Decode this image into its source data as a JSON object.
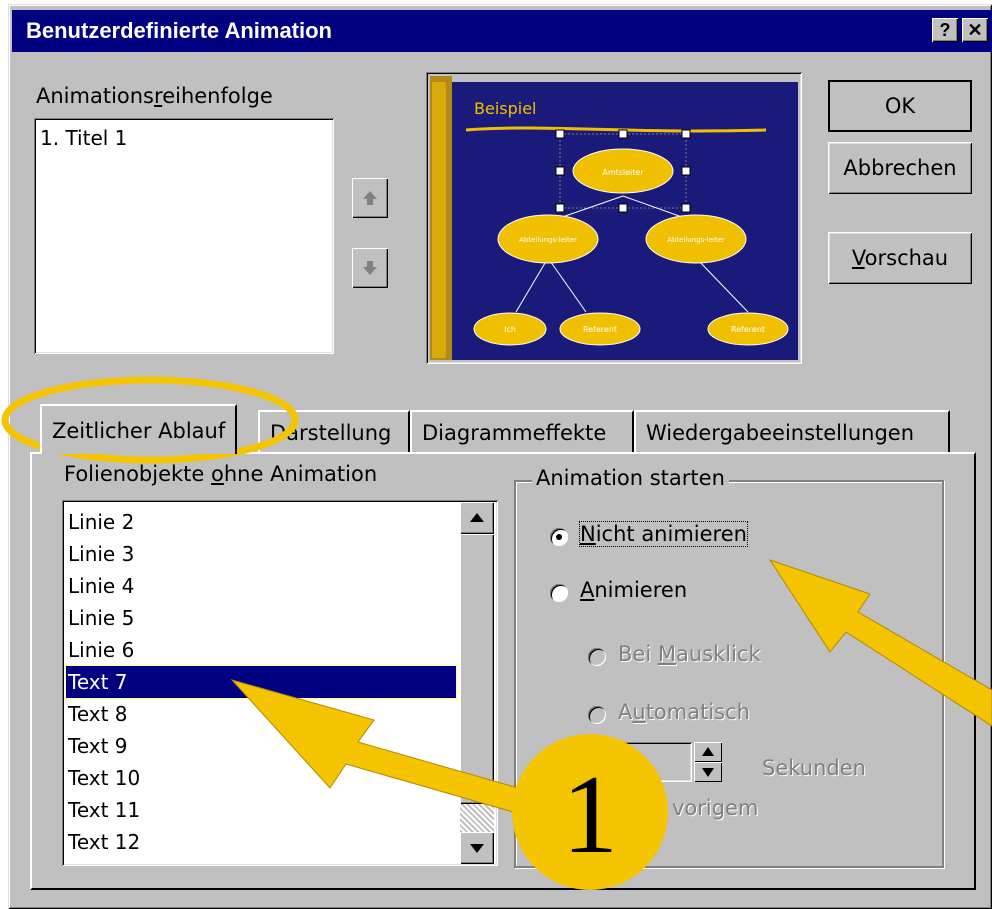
{
  "dialog": {
    "title": "Benutzerdefinierte Animation",
    "help_label": "?",
    "close_label": "✕"
  },
  "order": {
    "label_pre": "Animations",
    "label_u": "r",
    "label_post": "eihenfolge",
    "items": [
      "1. Titel 1"
    ]
  },
  "buttons": {
    "ok": "OK",
    "cancel": "Abbrechen",
    "preview_u": "V",
    "preview_rest": "orschau"
  },
  "slide": {
    "title": "Beispiel",
    "nodes": [
      "Amtsleiter",
      "Abteilungs-leiter",
      "Abteilungs-leiter",
      "Ich",
      "Referent",
      "Referent"
    ],
    "colors": {
      "background": "#1a1a7a",
      "node": "#f0c000",
      "accent": "#f0c000"
    }
  },
  "tabs": [
    "Zeitlicher Ablauf",
    "Darstellung",
    "Diagrammeffekte",
    "Wiedergabeeinstellungen"
  ],
  "objects": {
    "label_pre": "Folienobjekte ",
    "label_u": "o",
    "label_post": "hne Animation",
    "items": [
      "Linie 2",
      "Linie 3",
      "Linie 4",
      "Linie 5",
      "Linie 6",
      "Text 7",
      "Text 8",
      "Text 9",
      "Text 10",
      "Text 11",
      "Text 12"
    ],
    "selected": "Text 7"
  },
  "start": {
    "group_label": "Animation starten",
    "not_animate_u": "N",
    "not_animate_rest": "icht animieren",
    "animate_u": "A",
    "animate_rest": "nimieren",
    "on_click_pre": "Bei ",
    "on_click_u": "M",
    "on_click_post": "ausklick",
    "auto_pre": "A",
    "auto_u": "u",
    "auto_post": "tomatisch",
    "seconds": "Sekunden",
    "after_prev": "n vorigem"
  },
  "annotation": {
    "number": "1",
    "color": "#f5c400"
  }
}
